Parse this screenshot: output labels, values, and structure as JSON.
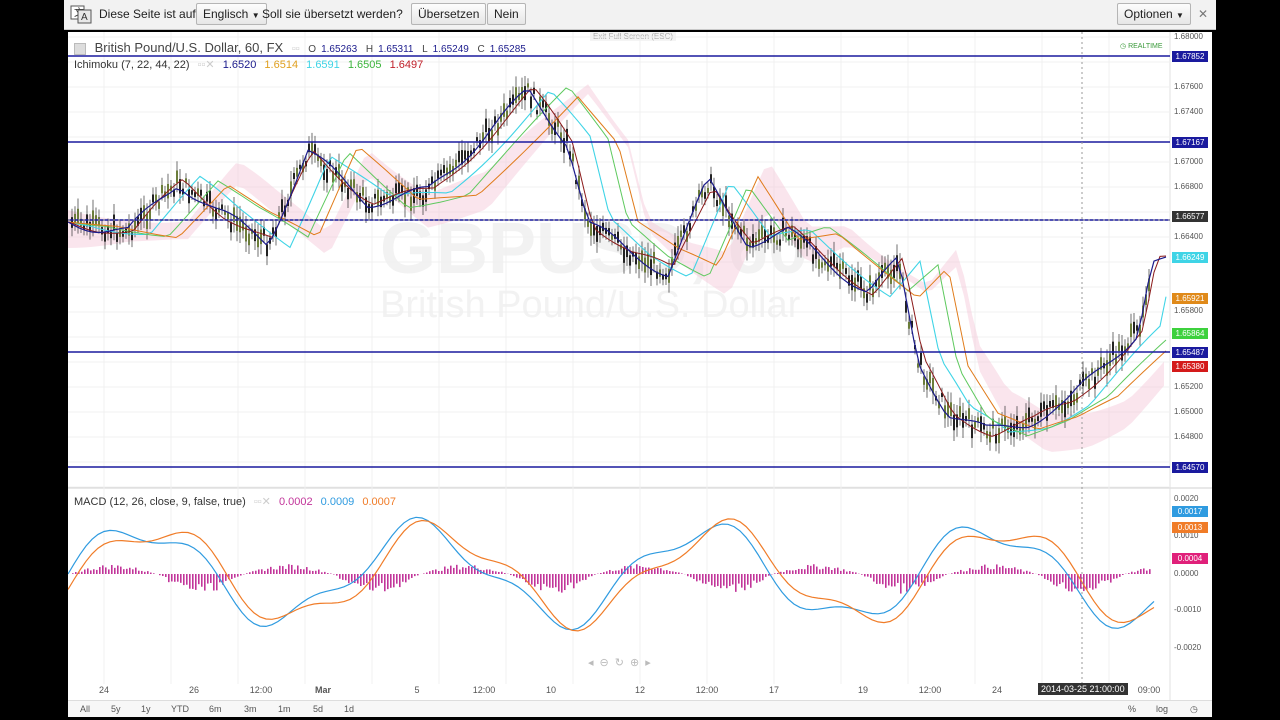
{
  "translate_bar": {
    "prompt": "Diese Seite ist auf",
    "language": "Englisch",
    "question": "Soll sie übersetzt werden?",
    "translate_button": "Übersetzen",
    "no_button": "Nein",
    "options_button": "Optionen",
    "close_label": "✕"
  },
  "chart": {
    "exit_fullscreen": "Exit Full Screen (ESC)",
    "title": "British Pound/U.S. Dollar, 60, FX",
    "ohlc": {
      "o_label": "O",
      "o": "1.65263",
      "h_label": "H",
      "h": "1.65311",
      "l_label": "L",
      "l": "1.65249",
      "c_label": "C",
      "c": "1.65285"
    },
    "realtime_label": "REALTIME",
    "watermark_symbol": "GBPUSD, 60",
    "watermark_name": "British Pound/U.S. Dollar",
    "ichimoku": {
      "label": "Ichimoku (7, 22, 44, 22)",
      "v1": "1.6520",
      "v2": "1.6514",
      "v3": "1.6591",
      "v4": "1.6505",
      "v5": "1.6497"
    },
    "macd": {
      "label": "MACD (12, 26, close, 9, false, true)",
      "v1": "0.0002",
      "v2": "0.0009",
      "v3": "0.0007"
    },
    "price_axis": [
      "1.68000",
      "1.67600",
      "1.67400",
      "1.67000",
      "1.66800",
      "1.66400",
      "1.65800",
      "1.65200",
      "1.65000",
      "1.64800"
    ],
    "level_labels": [
      "1.67852",
      "1.67167",
      "1.66577",
      "1.66249",
      "1.65921",
      "1.65864",
      "1.65487",
      "1.65380",
      "1.64570"
    ],
    "macd_axis": [
      "0.0020",
      "0.0010",
      "0.0000",
      "-0.0010",
      "-0.0020"
    ],
    "macd_labels": [
      "0.0017",
      "0.0013",
      "0.0004"
    ],
    "x_axis": [
      "24",
      "26",
      "12:00",
      "Mar",
      "5",
      "12:00",
      "10",
      "12",
      "12:00",
      "17",
      "19",
      "12:00",
      "24",
      "09:00"
    ],
    "crosshair_time": "2014-03-25 21:00:00",
    "range_buttons": [
      "All",
      "5y",
      "1y",
      "YTD",
      "6m",
      "3m",
      "1m",
      "5d",
      "1d"
    ],
    "bottom_right": [
      "%",
      "log"
    ],
    "colors": {
      "level_line": "#1a1a9e",
      "tenkan": "#1b1b8c",
      "kijun": "#8b1a1a",
      "chikou": "#3fd4e6",
      "senkou_a": "#5ec95e",
      "senkou_b": "#e07b1a",
      "cloud": "#f5c6d8",
      "macd": "#2f9be0",
      "signal": "#f07c28",
      "histogram": "#c2359a"
    }
  }
}
